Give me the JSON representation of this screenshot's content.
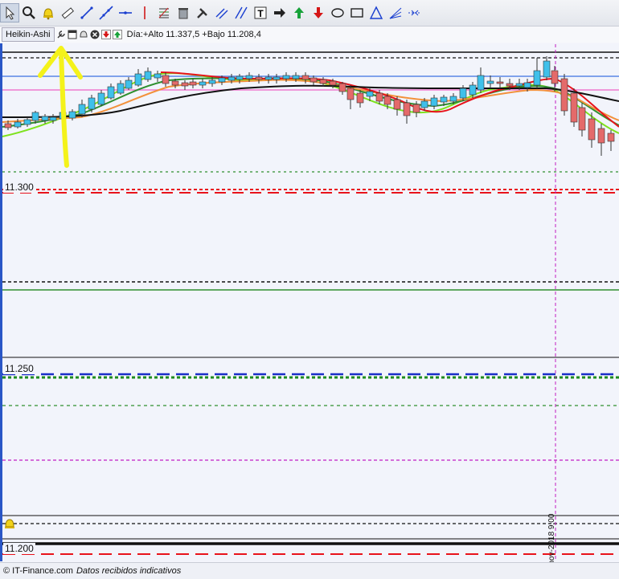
{
  "toolbar": {
    "tools": [
      {
        "name": "pointer-icon",
        "active": true
      },
      {
        "name": "zoom-icon"
      },
      {
        "name": "alarm-bell-icon"
      },
      {
        "name": "ruler-icon"
      },
      {
        "name": "trendline-icon"
      },
      {
        "name": "trendline-extended-icon"
      },
      {
        "name": "horizontal-line-icon"
      },
      {
        "name": "vertical-line-icon"
      },
      {
        "name": "fibonacci-icon"
      },
      {
        "name": "trash-icon"
      },
      {
        "name": "settings-tools-icon"
      },
      {
        "name": "channel-icon"
      },
      {
        "name": "parallel-lines-icon"
      },
      {
        "name": "text-icon"
      },
      {
        "name": "arrow-right-icon"
      },
      {
        "name": "arrow-up-green-icon"
      },
      {
        "name": "arrow-down-red-icon"
      },
      {
        "name": "ellipse-icon"
      },
      {
        "name": "rectangle-icon"
      },
      {
        "name": "triangle-icon"
      },
      {
        "name": "fan-icon"
      },
      {
        "name": "cross-icon"
      }
    ]
  },
  "indicator": {
    "name": "Heikin-Ashi",
    "day_info": "Día:+Alto 11.337,5 +Bajo 11.208,4"
  },
  "price_labels": {
    "p1": "11.300",
    "p2": "11.250",
    "p3": "11.200"
  },
  "date_label": "30-nov-2018 9:00",
  "footer": {
    "copyright": "© IT-Finance.com",
    "note": "Datos recibidos indicativos"
  },
  "colors": {
    "up_candle": "#3fc0ea",
    "down_candle": "#e46a6a",
    "ma_red": "#e8121b",
    "ma_green_light": "#7ee21e",
    "ma_green_dark": "#2f8f2f",
    "ma_orange": "#f2913b",
    "ma_black": "#111111",
    "hline_blue": "#5a86e6",
    "hline_pink": "#f07ad0",
    "arrow_yellow": "#f4f21a"
  }
}
